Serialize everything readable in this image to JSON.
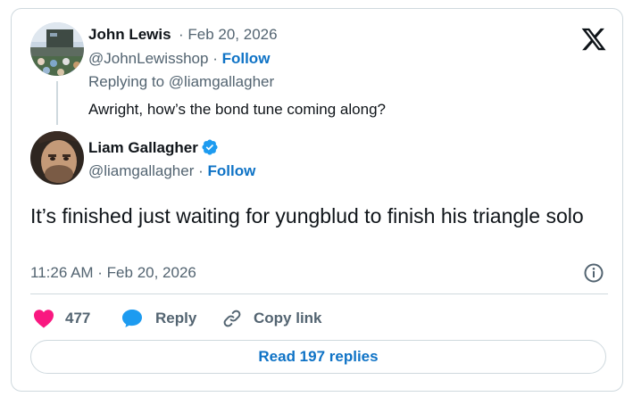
{
  "reply_tweet": {
    "author_name": "John Lewis",
    "date": "· Feb 20, 2026",
    "handle": "@JohnLewisshop",
    "separator": "·",
    "follow_label": "Follow",
    "replying_to": "Replying to @liamgallagher",
    "text": "Awright, how’s the bond tune coming along?"
  },
  "main_tweet": {
    "author_name": "Liam Gallagher",
    "handle": "@liamgallagher",
    "separator": "·",
    "follow_label": "Follow",
    "text": "It’s finished just waiting for yungblud to finish his triangle solo",
    "timestamp": "11:26 AM · Feb 20, 2026"
  },
  "actions": {
    "likes_count": "477",
    "reply_label": "Reply",
    "copy_link_label": "Copy link"
  },
  "read_replies_label": "Read 197 replies",
  "colors": {
    "accent_blue": "#0f73c6",
    "like_pink": "#f91880",
    "reply_blue": "#1d9bf0",
    "muted_text": "#536471",
    "border": "#cfd9de"
  },
  "icons": [
    "x-logo-icon",
    "verified-badge-icon",
    "info-icon",
    "heart-icon",
    "reply-bubble-icon",
    "link-icon"
  ]
}
